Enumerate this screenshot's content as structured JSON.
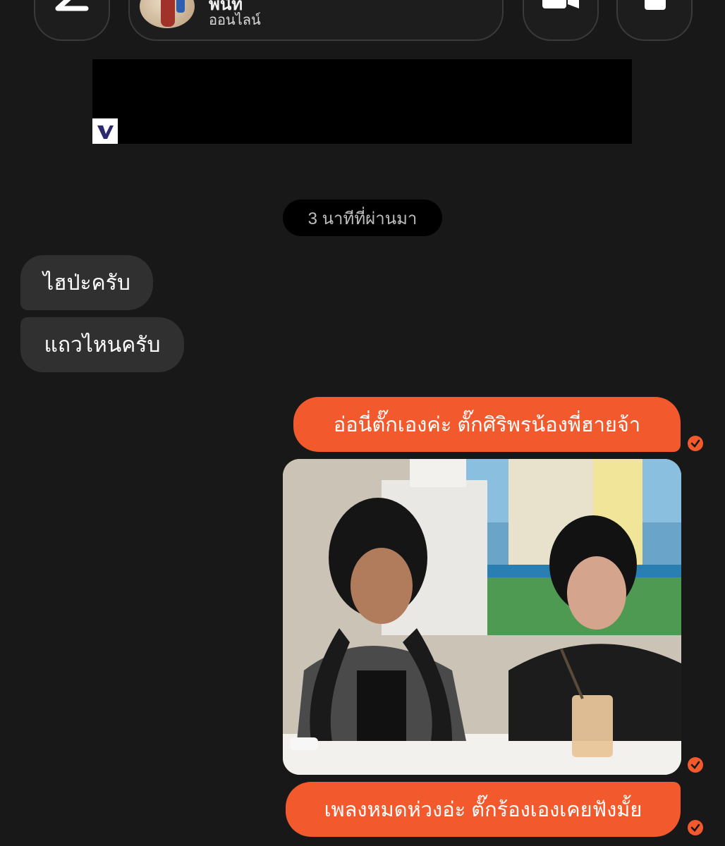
{
  "header": {
    "contact_name": "พีนัท",
    "contact_status": "ออนไลน์"
  },
  "timestamp": "3 นาทีที่ผ่านมา",
  "messages_incoming": [
    "ไฮป่ะครับ",
    "แถวไหนครับ"
  ],
  "messages_outgoing": [
    "อ่อนี่ตั๊กเองค่ะ  ตั๊กศิริพรน้องพี่ฮายจ้า",
    "เพลงหมดห่วงอ่ะ ตั๊กร้องเองเคยฟังมั้ย"
  ],
  "icons": {
    "back": "arrow-left-icon",
    "video": "video-camera-icon",
    "call": "phone-icon",
    "read_receipt": "check-circle-icon"
  },
  "colors": {
    "background": "#181818",
    "outgoing_bubble": "#f2592c",
    "incoming_bubble": "#303030"
  }
}
